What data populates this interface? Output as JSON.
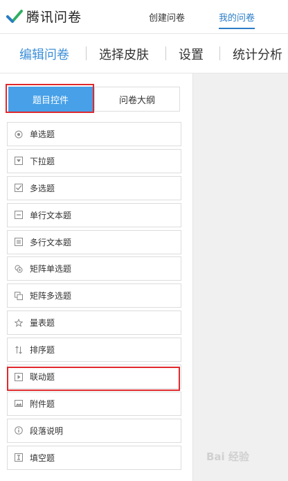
{
  "header": {
    "logo_text": "腾讯问卷",
    "nav": [
      {
        "label": "创建问卷",
        "active": false
      },
      {
        "label": "我的问卷",
        "active": true
      }
    ]
  },
  "tabs": [
    {
      "label": "编辑问卷",
      "active": true
    },
    {
      "label": "选择皮肤",
      "active": false
    },
    {
      "label": "设置",
      "active": false
    },
    {
      "label": "统计分析",
      "active": false
    }
  ],
  "sidebar": {
    "segment_primary": "题目控件",
    "segment_secondary": "问卷大纲",
    "items": [
      {
        "label": "单选题",
        "icon": "radio-icon"
      },
      {
        "label": "下拉题",
        "icon": "dropdown-icon"
      },
      {
        "label": "多选题",
        "icon": "checkbox-icon"
      },
      {
        "label": "单行文本题",
        "icon": "single-line-text-icon"
      },
      {
        "label": "多行文本题",
        "icon": "multi-line-text-icon"
      },
      {
        "label": "矩阵单选题",
        "icon": "matrix-radio-icon"
      },
      {
        "label": "矩阵多选题",
        "icon": "matrix-checkbox-icon"
      },
      {
        "label": "量表题",
        "icon": "star-icon"
      },
      {
        "label": "排序题",
        "icon": "sort-icon"
      },
      {
        "label": "联动题",
        "icon": "linkage-icon"
      },
      {
        "label": "附件题",
        "icon": "image-attachment-icon"
      },
      {
        "label": "段落说明",
        "icon": "info-icon"
      },
      {
        "label": "填空题",
        "icon": "fill-blank-icon"
      }
    ]
  },
  "watermark": "Bai 经验",
  "colors": {
    "accent": "#47a0e8",
    "active_text": "#3d8fd8",
    "highlight": "#e0282c",
    "canvas": "#f0f0f0"
  }
}
